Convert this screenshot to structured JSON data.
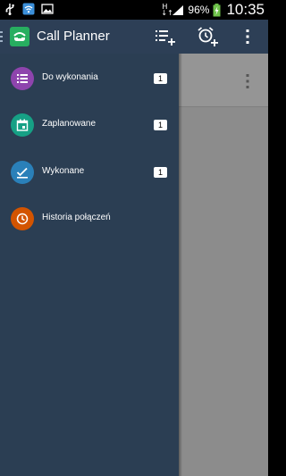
{
  "status_bar": {
    "net_type_top": "H",
    "net_type_bottom": "↓↑",
    "battery_percent": "96%",
    "time": "10:35",
    "icons": [
      "usb-icon",
      "wifi-icon",
      "image-icon",
      "signal-icon",
      "battery-charging-icon"
    ]
  },
  "app_bar": {
    "title": "Call Planner",
    "actions": [
      "add-list-icon",
      "add-alarm-icon",
      "overflow-menu-icon"
    ]
  },
  "drawer": {
    "items": [
      {
        "label": "Do wykonania",
        "badge": "1",
        "icon": "list-icon",
        "color": "#8e44ad"
      },
      {
        "label": "Zaplanowane",
        "badge": "1",
        "icon": "calendar-icon",
        "color": "#16a085"
      },
      {
        "label": "Wykonane",
        "badge": "1",
        "icon": "check-icon",
        "color": "#2a80b9"
      },
      {
        "label": "Historia połączeń",
        "badge": "",
        "icon": "clock-icon",
        "color": "#d35400"
      }
    ]
  },
  "colors": {
    "drawer_bg": "#2b3e53",
    "app_bar_bg": "#2d3f56",
    "dimmed_content": "#8c8c8c",
    "logo_green": "#27ae60"
  }
}
